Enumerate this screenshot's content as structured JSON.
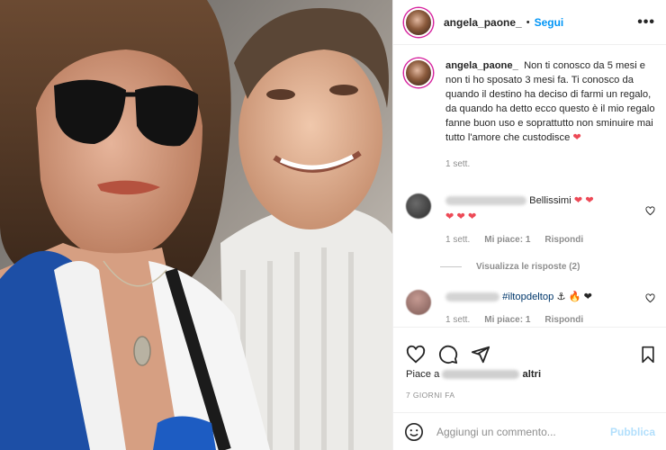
{
  "header": {
    "username": "angela_paone_",
    "dot": "•",
    "follow_label": "Segui",
    "more": "•••"
  },
  "caption": {
    "username": "angela_paone_",
    "text": "Non ti conosco da 5 mesi e non ti ho sposato 3 mesi fa. Ti conosco da quando il destino ha deciso di farmi un regalo, da quando ha detto ecco questo è il mio regalo fanne buon uso e soprattutto non sminuire mai tutto l'amore che custodisce",
    "emoji": "❤",
    "time": "1 sett."
  },
  "comments": [
    {
      "text": "Bellissimi",
      "emoji": "❤ ❤",
      "emoji2": "❤ ❤ ❤",
      "time": "1 sett.",
      "likes": "Mi piace: 1",
      "reply_label": "Rispondi",
      "view_replies": "Visualizza le risposte (2)"
    },
    {
      "text": "#iltopdeltop",
      "emoji": "⚓ 🔥 ❤",
      "time": "1 sett.",
      "likes": "Mi piace: 1",
      "reply_label": "Rispondi"
    }
  ],
  "likes": {
    "prefix": "Piace a",
    "suffix": "altri"
  },
  "timestamp": "7 GIORNI FA",
  "add_comment": {
    "placeholder": "Aggiungi un commento...",
    "publish_label": "Pubblica"
  },
  "colors": {
    "link": "#0095f6",
    "heart": "#ed4956",
    "muted": "#8e8e8e",
    "publish_disabled": "#b2dffc"
  },
  "icons": {
    "like": "heart-icon",
    "comment": "comment-icon",
    "share": "share-icon",
    "save": "bookmark-icon",
    "emoji": "smiley-icon"
  }
}
